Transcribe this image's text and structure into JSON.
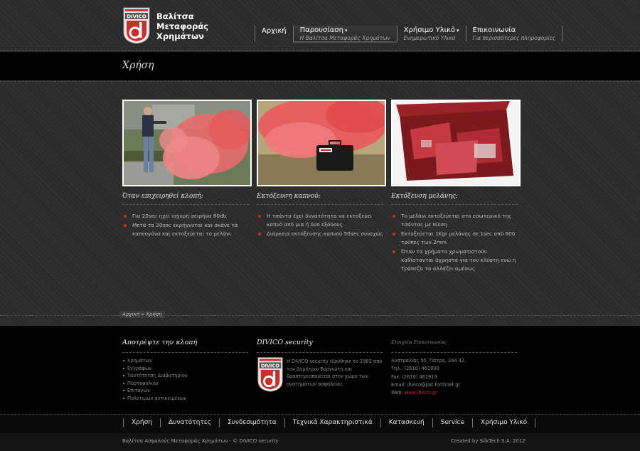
{
  "brand": {
    "logo_text": "DIVICO",
    "title_line1": "Βαλίτσα",
    "title_line2": "Μεταφοράς",
    "title_line3": "Χρημάτων"
  },
  "nav": [
    {
      "label": "Αρχική",
      "sub": ""
    },
    {
      "label": "Παρουσίαση",
      "sub": "Η Βαλίτσα Μεταφοράς Χρημάτων"
    },
    {
      "label": "Χρήσιμο Υλικό",
      "sub": "Ενημερωτικό Υλικό"
    },
    {
      "label": "Επικοινωνία",
      "sub": "Για περισσότερες πληροφορίες"
    }
  ],
  "page_title": "Χρήση",
  "cards": [
    {
      "title": "Όταν επιχειρηθεί κλοπή:",
      "bullets": [
        "Για 20sec ηχεί ισχυρή σειρήνα 80db",
        "Μετά τα 20sec εκρήγνυται και σκάνε τα καπνογόνα και εκτοξεύεται το μελάνι"
      ]
    },
    {
      "title": "Εκτόξευση καπνού:",
      "bullets": [
        "Η τσάντα έχει δυνατότητα να εκτοξεύει καπνό από μια ή δυο εξόδους",
        "Διάρκεια εκτόξευσης καπνού 50sec συνεχώς"
      ]
    },
    {
      "title": "Εκτόξευση μελάνης:",
      "bullets": [
        "Το μελάνι εκτοξεύεται στο εσωτερικό της τσάντας με πίεση",
        "Εκτοξεύεται 1Kgr μελάνης σε 1sec από 600 τρύπες των 2mm",
        "Όταν τα χρήματα χρωματιστούν καθίστανται άχρηστα για τον κλέφτη ενώ η Τράπεζα τα αλλάζει αμέσως"
      ]
    }
  ],
  "breadcrumb": "Αρχική » Χρήση",
  "footer": {
    "col1_title": "Αποτρέψτε την κλοπή",
    "col1_items": [
      "Χρημάτων",
      "Εγγράφων",
      "Ταυτότητας Διαβατηρίου",
      "Πορτοφολιού",
      "Επιταγών",
      "Πολύτιμων αντικειμένων"
    ],
    "col2_title": "DIVICO security",
    "col2_text": "Η DIVICO security ιδρύθηκε το 1983 από τον Δημήτριο Βυργιώτη και δραστηριοποιείται στον χώρο των συστημάτων ασφαλείας.",
    "col3_title": "Στοιχεία Επικοινωνίας",
    "address": "Αυστραλίας 95, Πάτρα, 264 42.",
    "phone": "Τηλ.: (2610) 461900",
    "fax": "Fax: (2610) 461919",
    "email": "Email: divico@pat.forthnet.gr",
    "web_label": "Web: ",
    "web_link": "www.divico.gr"
  },
  "bottom_nav": [
    "Χρήση",
    "Δυνατότητες",
    "Συνδεσιμότητα",
    "Τεχνικά Χαρακτηριστικά",
    "Κατασκευή",
    "Service",
    "Χρήσιμο Υλικό"
  ],
  "copyright_left": "Βαλίτσα Ασφαλούς Μεταφοράς Χρημάτων - © DIVICO security",
  "copyright_right": "Created by SilkTech S.A. 2012",
  "colors": {
    "accent": "#c4322a",
    "background": "#2a2a2a",
    "bar": "#000000"
  }
}
